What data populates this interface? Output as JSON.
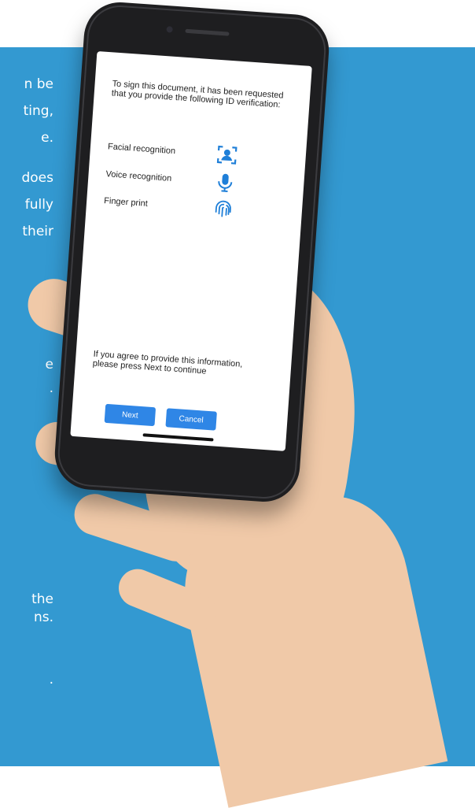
{
  "background": {
    "color": "#3399d1",
    "text_fragments": [
      "n be",
      "ting,",
      "e.",
      "does",
      "fully",
      "their",
      "e",
      ".",
      "the",
      "ns.",
      "."
    ]
  },
  "phone": {
    "screen": {
      "intro": "To sign this document, it has been requested that you provide the following ID verification:",
      "items": [
        {
          "label": "Facial recognition",
          "icon": "face-id-icon"
        },
        {
          "label": "Voice recognition",
          "icon": "microphone-icon"
        },
        {
          "label": "Finger print",
          "icon": "fingerprint-icon"
        }
      ],
      "outro": "If you agree to provide this information, please press Next to continue",
      "next_label": "Next",
      "cancel_label": "Cancel",
      "accent_color": "#2f86e6"
    }
  }
}
